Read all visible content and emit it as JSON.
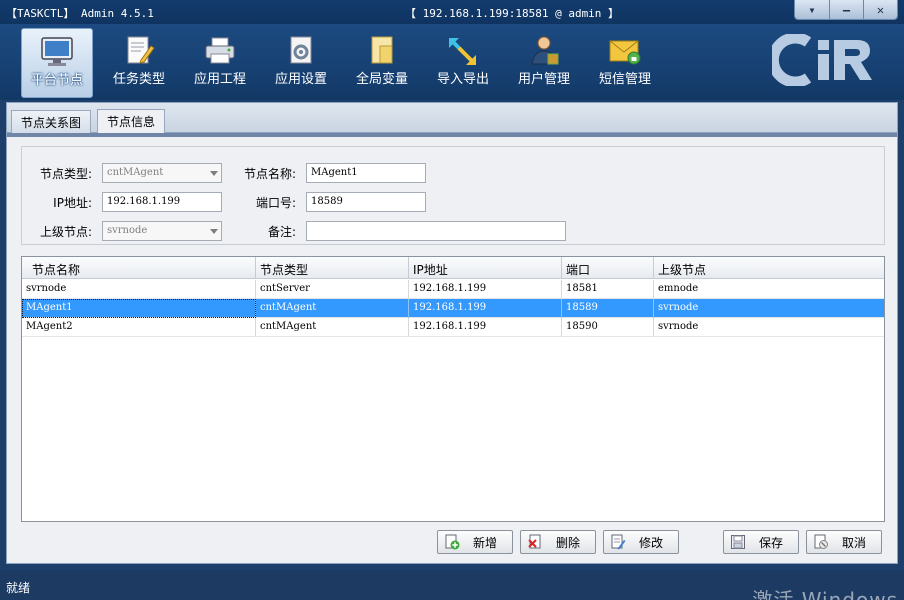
{
  "window": {
    "title": "【TASKCTL】 Admin 4.5.1",
    "connection": "【 192.168.1.199:18581 @ admin 】",
    "controls": {
      "menu_glyph": "▾",
      "minimize_glyph": "—",
      "close_glyph": "✕"
    }
  },
  "nav": {
    "items": [
      {
        "label": "平台节点",
        "icon": "monitor-icon",
        "active": true
      },
      {
        "label": "任务类型",
        "icon": "task-edit-icon",
        "active": false
      },
      {
        "label": "应用工程",
        "icon": "printer-icon",
        "active": false
      },
      {
        "label": "应用设置",
        "icon": "settings-doc-icon",
        "active": false
      },
      {
        "label": "全局变量",
        "icon": "folder-doc-icon",
        "active": false
      },
      {
        "label": "导入导出",
        "icon": "import-export-icon",
        "active": false
      },
      {
        "label": "用户管理",
        "icon": "user-icon",
        "active": false
      },
      {
        "label": "短信管理",
        "icon": "sms-envelope-icon",
        "active": false
      }
    ],
    "brand_text": "CiR"
  },
  "tabs": [
    {
      "label": "节点关系图",
      "active": false
    },
    {
      "label": "节点信息",
      "active": true
    }
  ],
  "form": {
    "node_type_label": "节点类型:",
    "node_type_value": "cntMAgent",
    "node_name_label": "节点名称:",
    "node_name_value": "MAgent1",
    "ip_label": "IP地址:",
    "ip_value": "192.168.1.199",
    "port_label": "端口号:",
    "port_value": "18589",
    "parent_label": "上级节点:",
    "parent_value": "svrnode",
    "remark_label": "备注:",
    "remark_value": ""
  },
  "grid": {
    "columns": [
      "节点名称",
      "节点类型",
      "IP地址",
      "端口",
      "上级节点"
    ],
    "rows": [
      [
        "svrnode",
        "cntServer",
        "192.168.1.199",
        "18581",
        "emnode"
      ],
      [
        "MAgent1",
        "cntMAgent",
        "192.168.1.199",
        "18589",
        "svrnode"
      ],
      [
        "MAgent2",
        "cntMAgent",
        "192.168.1.199",
        "18590",
        "svrnode"
      ]
    ],
    "selected_row": 1
  },
  "buttons": {
    "add": "新增",
    "delete": "删除",
    "modify": "修改",
    "save": "保存",
    "cancel": "取消"
  },
  "status": {
    "text": "就绪",
    "watermark": "激活 Windows"
  },
  "colors": {
    "chrome": "#163f70",
    "selection": "#3399ff"
  }
}
